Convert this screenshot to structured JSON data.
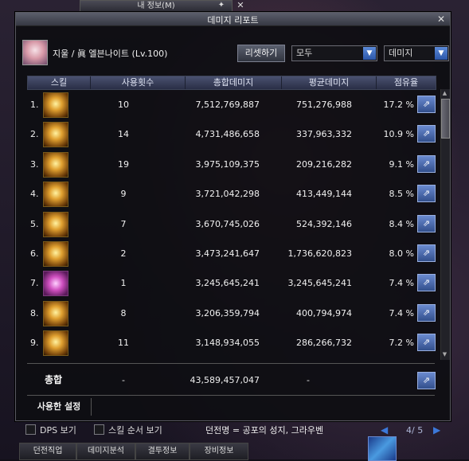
{
  "background_window": {
    "title": "내 정보(M)"
  },
  "dialog": {
    "title": "데미지 리포트"
  },
  "character": {
    "name": "지울 / 眞 엘븐나이트 (Lv.100)"
  },
  "controls": {
    "reset_label": "리셋하기",
    "filter_value": "모두",
    "mode_value": "데미지"
  },
  "columns": [
    "스킬",
    "사용횟수",
    "총합데미지",
    "평균데미지",
    "점유율"
  ],
  "rows": [
    {
      "rank": "1.",
      "uses": "10",
      "total": "7,512,769,887",
      "avg": "751,276,988",
      "share": "17.2 %",
      "icon": "golden-slash-skill-icon"
    },
    {
      "rank": "2.",
      "uses": "14",
      "total": "4,731,486,658",
      "avg": "337,963,332",
      "share": "10.9 %",
      "icon": "golden-crescent-skill-icon"
    },
    {
      "rank": "3.",
      "uses": "19",
      "total": "3,975,109,375",
      "avg": "209,216,282",
      "share": "9.1 %",
      "icon": "golden-burst-skill-icon"
    },
    {
      "rank": "4.",
      "uses": "9",
      "total": "3,721,042,298",
      "avg": "413,449,144",
      "share": "8.5 %",
      "icon": "golden-cross-skill-icon"
    },
    {
      "rank": "5.",
      "uses": "7",
      "total": "3,670,745,026",
      "avg": "524,392,146",
      "share": "8.4 %",
      "icon": "golden-spear-skill-icon"
    },
    {
      "rank": "6.",
      "uses": "2",
      "total": "3,473,241,647",
      "avg": "1,736,620,823",
      "share": "8.0 %",
      "icon": "golden-explosion-skill-icon"
    },
    {
      "rank": "7.",
      "uses": "1",
      "total": "3,245,645,241",
      "avg": "3,245,645,241",
      "share": "7.4 %",
      "icon": "purple-orb-skill-icon"
    },
    {
      "rank": "8.",
      "uses": "8",
      "total": "3,206,359,794",
      "avg": "400,794,974",
      "share": "7.4 %",
      "icon": "golden-shield-skill-icon"
    },
    {
      "rank": "9.",
      "uses": "11",
      "total": "3,148,934,055",
      "avg": "286,266,732",
      "share": "7.2 %",
      "icon": "golden-wave-skill-icon"
    }
  ],
  "total": {
    "label": "총합",
    "uses": "-",
    "value": "43,589,457,047",
    "avg": "-"
  },
  "settings_tab": "사용한 설정",
  "options": {
    "dps_label": "DPS 보기",
    "order_label": "스킬 순서 보기"
  },
  "dungeon": "던전명 = 공포의 성지, 그라우벤",
  "pagination": {
    "text": "4/ 5"
  },
  "bottom_tabs": [
    "던전직업",
    "데미지분석",
    "결투정보",
    "장비정보"
  ],
  "colors": {
    "accent_blue": "#3c78d8",
    "header_bg": "#2a2f46",
    "dialog_bg": "#0e0e12"
  }
}
